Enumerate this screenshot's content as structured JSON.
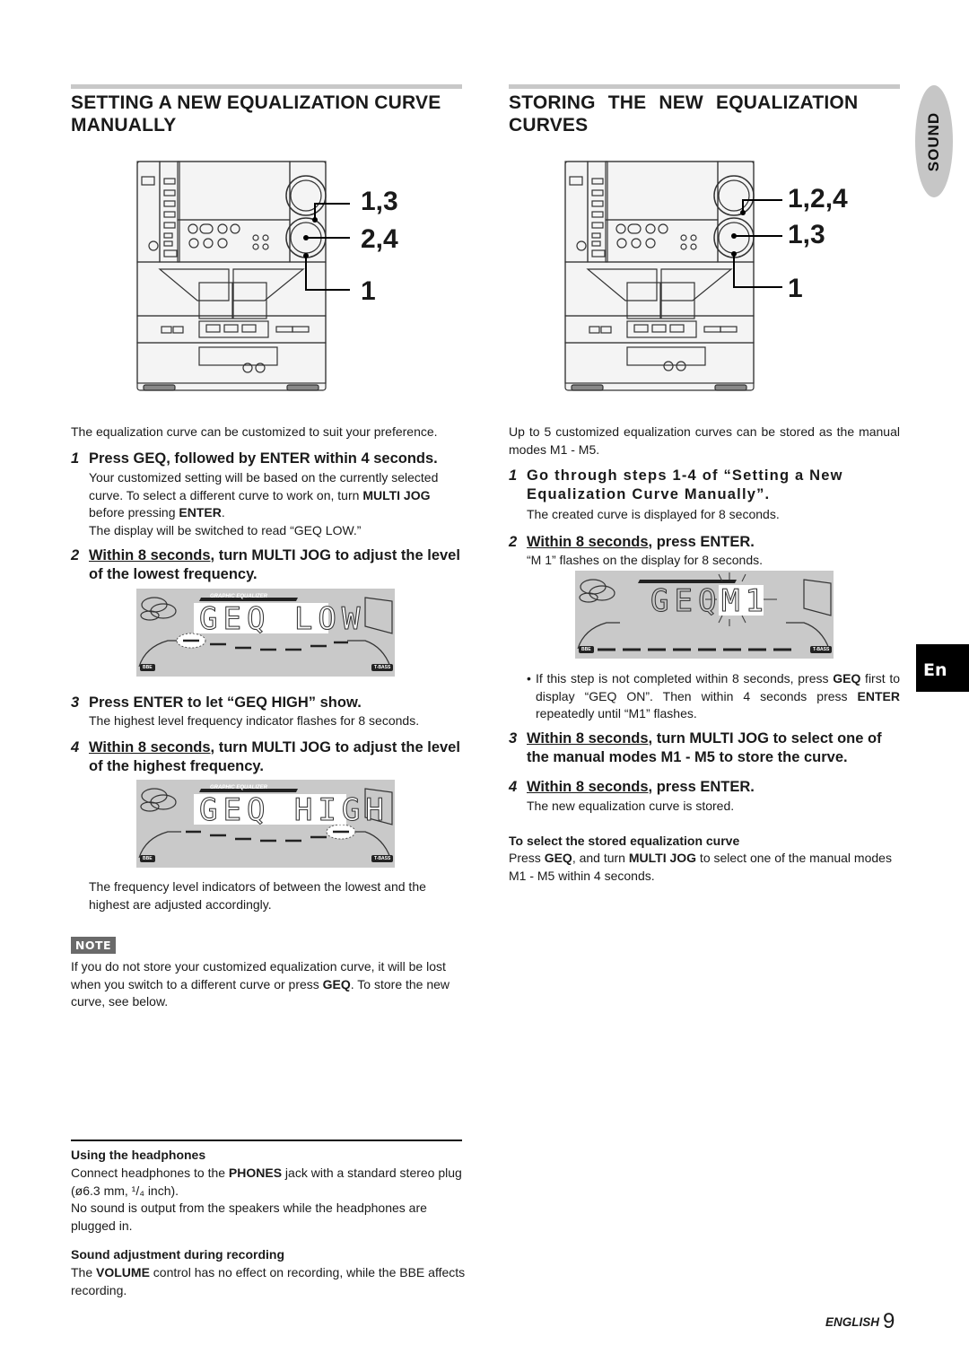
{
  "side_tabs": {
    "sound": "SOUND",
    "language": "En"
  },
  "left": {
    "heading": "SETTING  A NEW EQUALIZATION CURVE MANUALLY",
    "figure_callouts": [
      "1,3",
      "2,4",
      "1"
    ],
    "intro": "The equalization curve can be customized to suit your preference.",
    "steps": [
      {
        "num": "1",
        "title": "Press GEQ, followed by ENTER within 4 seconds.",
        "body_parts": [
          {
            "t": "Your customized setting will be based on the currently selected curve. To select a different curve to work on, turn "
          },
          {
            "t": "MULTI JOG",
            "bold": true
          },
          {
            "t": " before pressing "
          },
          {
            "t": "ENTER",
            "bold": true
          },
          {
            "t": "."
          }
        ],
        "body2": "The display will be switched to read “GEQ LOW.”"
      },
      {
        "num": "2",
        "title_underlined": "Within 8 seconds",
        "title_rest": ", turn MULTI JOG to adjust the level of the lowest frequency.",
        "display": {
          "label": "GRAPHIC EQUALIZER",
          "text": "GEQ LOW",
          "tag_left": "BBE",
          "tag_right": "T-BASS",
          "flashing_band": "lowest"
        }
      },
      {
        "num": "3",
        "title": "Press ENTER to let “GEQ HIGH” show.",
        "body": "The highest level frequency indicator flashes for 8 seconds."
      },
      {
        "num": "4",
        "title_underlined": "Within 8 seconds",
        "title_rest": ", turn MULTI JOG to adjust the level of the highest frequency.",
        "display": {
          "label": "GRAPHIC EQUALIZER",
          "text": "GEQ HIGH",
          "tag_left": "BBE",
          "tag_right": "T-BASS",
          "flashing_band": "highest"
        },
        "after": "The frequency level indicators of between the lowest and the highest are adjusted accordingly."
      }
    ],
    "note": {
      "badge": "NOTE",
      "parts": [
        {
          "t": "If you do not store your customized equalization curve, it will be lost when you switch to a different curve or press "
        },
        {
          "t": "GEQ",
          "bold": true
        },
        {
          "t": ". To store the new curve, see below."
        }
      ]
    },
    "headphones": {
      "heading": "Using the headphones",
      "parts": [
        {
          "t": "Connect headphones to the "
        },
        {
          "t": "PHONES",
          "bold": true
        },
        {
          "t": " jack with a standard stereo plug (ø6.3 mm, ¹/₄ inch)."
        }
      ],
      "body2": "No sound is output from the speakers while the headphones are plugged in."
    },
    "recording": {
      "heading": "Sound adjustment during recording",
      "parts": [
        {
          "t": "The "
        },
        {
          "t": "VOLUME",
          "bold": true
        },
        {
          "t": " control has no effect on recording, while the BBE affects recording."
        }
      ]
    }
  },
  "right": {
    "heading": "STORING THE NEW EQUALIZATION CURVES",
    "figure_callouts": [
      "1,2,4",
      "1,3",
      "1"
    ],
    "intro": "Up to 5 customized equalization curves can be stored as the manual modes M1 -  M5.",
    "steps": [
      {
        "num": "1",
        "title": "Go through steps 1-4 of “Setting a New Equalization Curve Manually”.",
        "body": "The created curve is displayed for 8 seconds."
      },
      {
        "num": "2",
        "title_underlined": "Within 8 seconds",
        "title_rest": ",  press ENTER.",
        "body": "“M 1” flashes on the display for 8 seconds.",
        "display": {
          "text_left": "GEQ",
          "text_flash": "M1",
          "tag_left": "BBE",
          "tag_right": "T-BASS"
        },
        "bullet_parts": [
          {
            "t": "If this step is not completed within 8 seconds, press "
          },
          {
            "t": "GEQ",
            "bold": true
          },
          {
            "t": " first to display “GEQ ON”. Then within 4 seconds press "
          },
          {
            "t": "ENTER",
            "bold": true
          },
          {
            "t": " repeatedly until “M1” flashes."
          }
        ]
      },
      {
        "num": "3",
        "title_underlined": "Within 8 seconds",
        "title_rest": ", turn MULTI JOG to select one of the manual modes M1 -  M5 to store the curve."
      },
      {
        "num": "4",
        "title_underlined": "Within 8 seconds",
        "title_rest": ", press ENTER.",
        "body": "The new equalization curve is stored."
      }
    ],
    "select_stored": {
      "heading": "To select the stored equalization curve",
      "parts": [
        {
          "t": "Press "
        },
        {
          "t": "GEQ",
          "bold": true
        },
        {
          "t": ", and turn "
        },
        {
          "t": "MULTI JOG",
          "bold": true
        },
        {
          "t": " to select one of the manual modes M1 -  M5 within 4 seconds."
        }
      ]
    }
  },
  "footer": {
    "language": "ENGLISH",
    "page": "9"
  }
}
